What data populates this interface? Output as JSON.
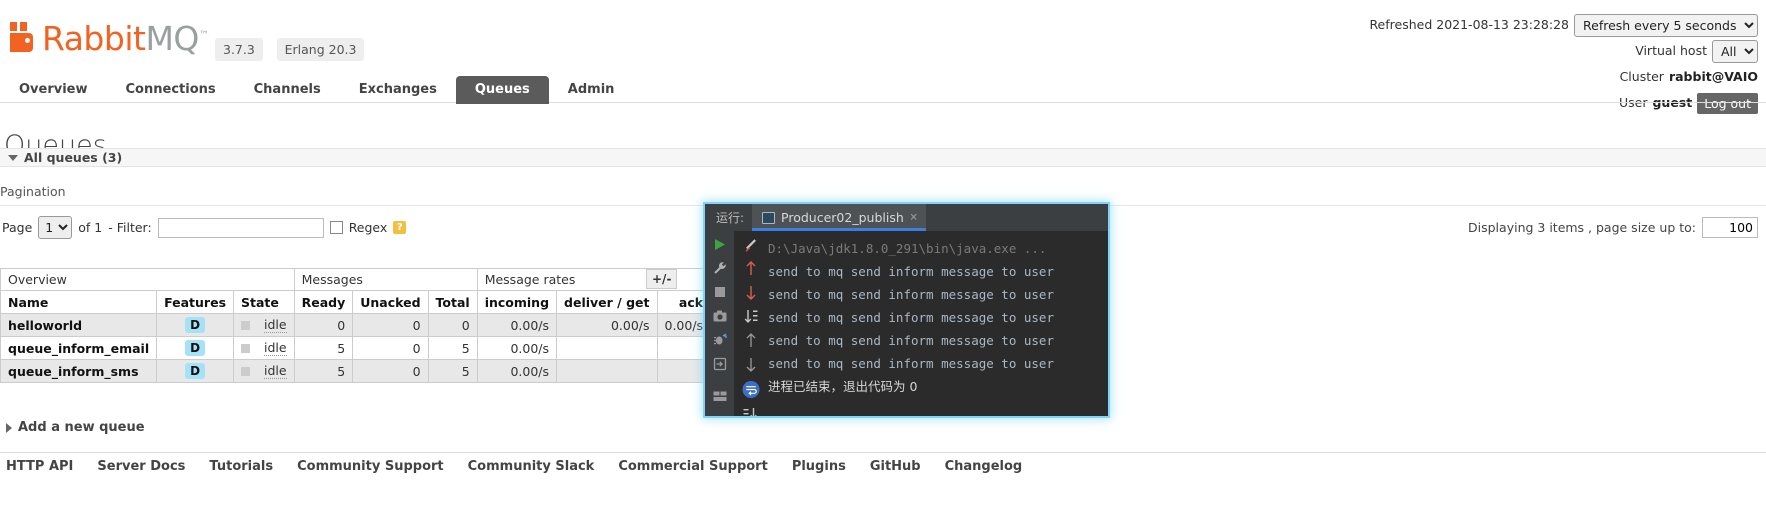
{
  "brand": {
    "name_part1": "Rabbit",
    "name_part2": "MQ",
    "tm": "™",
    "version": "3.7.3",
    "erlang": "Erlang 20.3"
  },
  "header": {
    "refreshed_label": "Refreshed 2021-08-13 23:28:28",
    "refresh_select": "Refresh every 5 seconds",
    "refresh_options": [
      "Refresh every 5 seconds"
    ],
    "vhost_label": "Virtual host",
    "vhost_value": "All",
    "vhost_options": [
      "All"
    ],
    "cluster_label": "Cluster",
    "cluster_value": "rabbit@VAIO",
    "user_label": "User",
    "user_value": "guest",
    "logout_label": "Log out"
  },
  "nav": {
    "items": [
      {
        "label": "Overview",
        "active": false
      },
      {
        "label": "Connections",
        "active": false
      },
      {
        "label": "Channels",
        "active": false
      },
      {
        "label": "Exchanges",
        "active": false
      },
      {
        "label": "Queues",
        "active": true
      },
      {
        "label": "Admin",
        "active": false
      }
    ]
  },
  "page": {
    "title": "Queues",
    "all_queues": "All queues (3)",
    "pagination_label": "Pagination",
    "page_label": "Page",
    "page_value": "1",
    "page_options": [
      "1"
    ],
    "of_label": "of 1",
    "filter_label": "- Filter:",
    "filter_value": "",
    "filter_placeholder": "",
    "regex_label": "Regex",
    "regex_checked": false,
    "help_glyph": "?",
    "displaying_label": "Displaying 3 items , page size up to:",
    "page_size": "100",
    "plus_minus": "+/-",
    "add_queue": "Add a new queue"
  },
  "table": {
    "group_headers": [
      {
        "label": "Overview",
        "span": 3
      },
      {
        "label": "Messages",
        "span": 3
      },
      {
        "label": "Message rates",
        "span": 3
      }
    ],
    "columns": [
      {
        "label": "Name",
        "align": "l"
      },
      {
        "label": "Features",
        "align": "c"
      },
      {
        "label": "State",
        "align": "l"
      },
      {
        "label": "Ready",
        "align": "r"
      },
      {
        "label": "Unacked",
        "align": "r"
      },
      {
        "label": "Total",
        "align": "r"
      },
      {
        "label": "incoming",
        "align": "r"
      },
      {
        "label": "deliver / get",
        "align": "r"
      },
      {
        "label": "ack",
        "align": "r"
      }
    ],
    "rows": [
      {
        "name": "helloworld",
        "features": "D",
        "state": "idle",
        "ready": "0",
        "unacked": "0",
        "total": "0",
        "incoming": "0.00/s",
        "deliver_get": "0.00/s",
        "ack": "0.00/s"
      },
      {
        "name": "queue_inform_email",
        "features": "D",
        "state": "idle",
        "ready": "5",
        "unacked": "0",
        "total": "5",
        "incoming": "0.00/s",
        "deliver_get": "",
        "ack": ""
      },
      {
        "name": "queue_inform_sms",
        "features": "D",
        "state": "idle",
        "ready": "5",
        "unacked": "0",
        "total": "5",
        "incoming": "0.00/s",
        "deliver_get": "",
        "ack": ""
      }
    ]
  },
  "footer": {
    "links": [
      "HTTP API",
      "Server Docs",
      "Tutorials",
      "Community Support",
      "Community Slack",
      "Commercial Support",
      "Plugins",
      "GitHub",
      "Changelog"
    ]
  },
  "console": {
    "run_label": "运行:",
    "tab_name": "Producer02_publish",
    "tab_close": "×",
    "lines": [
      {
        "gutter": "pencil",
        "text": "D:\\Java\\jdk1.8.0_291\\bin\\java.exe ...",
        "kind": "cmd"
      },
      {
        "gutter": "arrow-up-red",
        "text": "send to mq send inform message to user",
        "kind": "out"
      },
      {
        "gutter": "arrow-down-red",
        "text": "send to mq send inform message to user",
        "kind": "out"
      },
      {
        "gutter": "sort-down",
        "text": "send to mq send inform message to user",
        "kind": "out"
      },
      {
        "gutter": "arrow-up",
        "text": "send to mq send inform message to user",
        "kind": "out"
      },
      {
        "gutter": "arrow-down",
        "text": "send to mq send inform message to user",
        "kind": "out"
      },
      {
        "gutter": "soft-wrap",
        "text": "",
        "kind": "out"
      },
      {
        "gutter": "scroll-end",
        "text": "进程已结束，退出代码为 0",
        "kind": "exit"
      }
    ],
    "toolbar_icons": [
      "run-icon",
      "wrench-icon",
      "stop-icon",
      "camera-icon",
      "debug-icon",
      "export-icon",
      "layout-icon"
    ]
  },
  "colors": {
    "brand_orange": "#f26322",
    "tab_active_bg": "#5b5b5b",
    "feature_badge": "#a6e2f5",
    "console_bg": "#2b2b2b",
    "console_chrome": "#3c3f41",
    "console_glow": "#7fd3f7",
    "tab_underline": "#3d7fe0"
  }
}
